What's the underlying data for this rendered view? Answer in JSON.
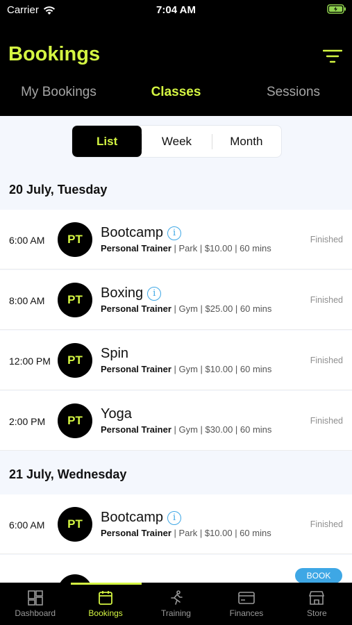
{
  "status": {
    "carrier": "Carrier",
    "time": "7:04 AM"
  },
  "header": {
    "title": "Bookings"
  },
  "tabs": [
    {
      "label": "My Bookings",
      "active": false
    },
    {
      "label": "Classes",
      "active": true
    },
    {
      "label": "Sessions",
      "active": false
    }
  ],
  "views": [
    {
      "label": "List",
      "active": true
    },
    {
      "label": "Week",
      "active": false
    },
    {
      "label": "Month",
      "active": false
    }
  ],
  "days": [
    {
      "date": "20 July, Tuesday",
      "classes": [
        {
          "time": "6:00 AM",
          "initials": "PT",
          "name": "Bootcamp",
          "trainer": "Personal Trainer",
          "details": " | Park | $10.00 | 60 mins",
          "status": "Finished"
        },
        {
          "time": "8:00 AM",
          "initials": "PT",
          "name": "Boxing",
          "trainer": "Personal Trainer",
          "details": " | Gym | $25.00 | 60 mins",
          "status": "Finished"
        },
        {
          "time": "12:00 PM",
          "initials": "PT",
          "name": "Spin",
          "trainer": "Personal Trainer",
          "details": " | Gym | $10.00 | 60 mins",
          "status": "Finished"
        },
        {
          "time": "2:00 PM",
          "initials": "PT",
          "name": "Yoga",
          "trainer": "Personal Trainer",
          "details": " | Gym | $30.00 | 60 mins",
          "status": "Finished"
        }
      ]
    },
    {
      "date": "21 July, Wednesday",
      "classes": [
        {
          "time": "6:00 AM",
          "initials": "PT",
          "name": "Bootcamp",
          "trainer": "Personal Trainer",
          "details": " | Park | $10.00 | 60 mins",
          "status": "Finished"
        }
      ]
    }
  ],
  "book_label": "BOOK",
  "nav": [
    {
      "label": "Dashboard",
      "icon": "dashboard-icon",
      "active": false
    },
    {
      "label": "Bookings",
      "icon": "calendar-icon",
      "active": true
    },
    {
      "label": "Training",
      "icon": "running-icon",
      "active": false
    },
    {
      "label": "Finances",
      "icon": "card-icon",
      "active": false
    },
    {
      "label": "Store",
      "icon": "store-icon",
      "active": false
    }
  ],
  "colors": {
    "accent": "#d4f542",
    "info": "#3ea7e5",
    "dark": "#000000"
  }
}
